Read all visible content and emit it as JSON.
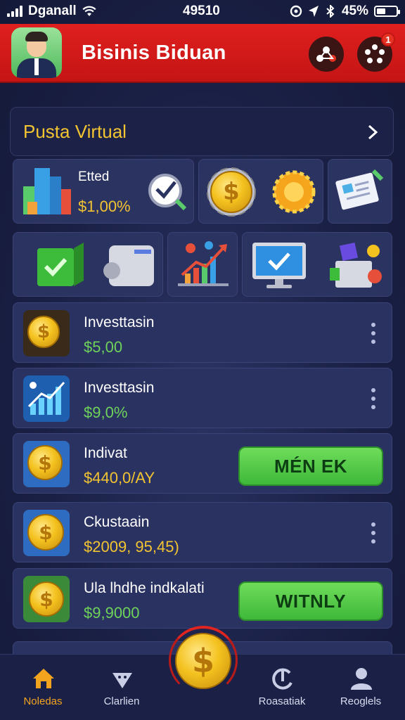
{
  "status_bar": {
    "carrier": "Dganall",
    "time": "49510",
    "battery": "45%",
    "battery_level": 0.45
  },
  "header": {
    "title": "Bisinis Biduan",
    "notification_count": "1"
  },
  "section": {
    "title": "Pusta Virtual"
  },
  "summary_tile": {
    "label": "Etted",
    "value": "$1,00%"
  },
  "list": [
    {
      "title": "Investtasin",
      "value": "$5,00",
      "value_color": "#6fd35a",
      "action": "menu"
    },
    {
      "title": "Investtasin",
      "value": "$9,0%",
      "value_color": "#6fd35a",
      "action": "menu"
    },
    {
      "title": "Indivat",
      "value": "$440,0/AY",
      "value_color": "#f3c431",
      "action": "button",
      "button_label": "MÉN EK"
    },
    {
      "title": "Ckustaain",
      "value": "$2009, 95,45)",
      "value_color": "#f3c431",
      "action": "menu"
    },
    {
      "title": "Ula lhdhe indkalati",
      "value": "$9,9000",
      "value_color": "#6fd35a",
      "action": "button",
      "button_label": "WITNLY"
    }
  ],
  "bottom_nav": [
    {
      "label": "Noledas",
      "icon": "home-icon",
      "active": true
    },
    {
      "label": "Clarlien",
      "icon": "diamond-icon",
      "active": false
    },
    {
      "label": "Roasatiak",
      "icon": "refresh-icon",
      "active": false
    },
    {
      "label": "Reoglels",
      "icon": "profile-icon",
      "active": false
    }
  ],
  "colors": {
    "header_red": "#d91b1b",
    "accent_gold": "#f3c431",
    "accent_green": "#4cc94a",
    "background": "#1a2045"
  }
}
